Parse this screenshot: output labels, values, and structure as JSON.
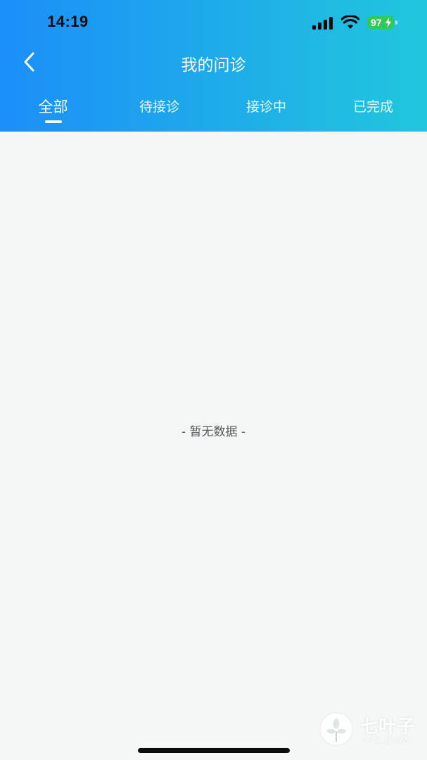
{
  "status_bar": {
    "time": "14:19",
    "battery": "97",
    "icons": [
      "signal-icon",
      "wifi-icon",
      "battery-icon",
      "charging-bolt-icon"
    ]
  },
  "nav": {
    "title": "我的问诊",
    "back_icon": "chevron-left-icon"
  },
  "tabs": [
    {
      "label": "全部",
      "active": true
    },
    {
      "label": "待接诊",
      "active": false
    },
    {
      "label": "接诊中",
      "active": false
    },
    {
      "label": "已完成",
      "active": false
    }
  ],
  "content": {
    "empty_text": "- 暂无数据 -"
  },
  "watermark": {
    "brand": "七叶子",
    "domain": "7YZ.COM"
  },
  "colors": {
    "header_gradient_start": "#1b8ff9",
    "header_gradient_end": "#21c7dd",
    "background": "#f5f6f6",
    "battery_green": "#34c759"
  }
}
